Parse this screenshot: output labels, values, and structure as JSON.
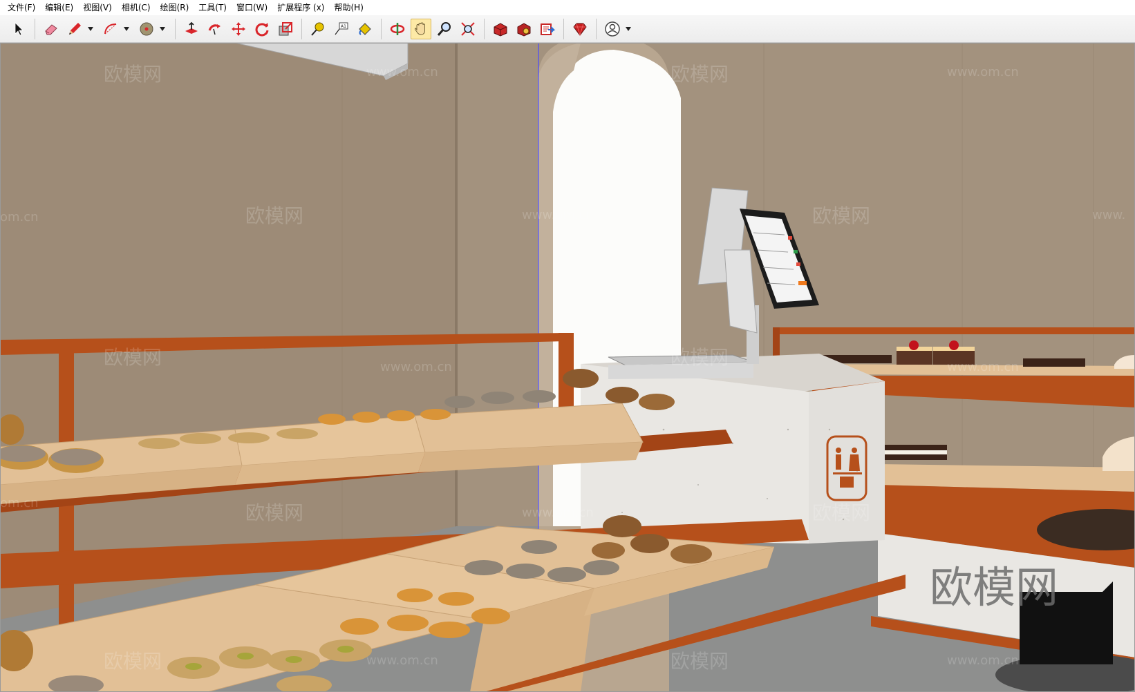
{
  "menubar": {
    "items": [
      {
        "id": "file",
        "label": "文件(F)"
      },
      {
        "id": "edit",
        "label": "编辑(E)"
      },
      {
        "id": "view",
        "label": "视图(V)"
      },
      {
        "id": "camera",
        "label": "相机(C)"
      },
      {
        "id": "draw",
        "label": "绘图(R)"
      },
      {
        "id": "tools",
        "label": "工具(T)"
      },
      {
        "id": "window",
        "label": "窗口(W)"
      },
      {
        "id": "extensions",
        "label": "扩展程序 (x)"
      },
      {
        "id": "help",
        "label": "帮助(H)"
      }
    ]
  },
  "toolbar": {
    "tools": [
      {
        "name": "select-tool",
        "icon": "arrow-cursor-icon"
      },
      {
        "name": "eraser-tool",
        "icon": "eraser-icon"
      },
      {
        "name": "pencil-tool",
        "icon": "pencil-icon",
        "dropdown": true
      },
      {
        "name": "arc-tool",
        "icon": "arc-icon",
        "dropdown": true
      },
      {
        "name": "shape-tool",
        "icon": "circle-shape-icon",
        "dropdown": true
      },
      {
        "name": "push-pull-tool",
        "icon": "push-pull-icon"
      },
      {
        "name": "follow-me-tool",
        "icon": "follow-me-icon"
      },
      {
        "name": "move-tool",
        "icon": "move-icon"
      },
      {
        "name": "rotate-tool",
        "icon": "rotate-icon"
      },
      {
        "name": "scale-tool",
        "icon": "scale-icon"
      },
      {
        "name": "tape-measure-tool",
        "icon": "tape-measure-icon"
      },
      {
        "name": "text-tool",
        "icon": "text-icon"
      },
      {
        "name": "paint-bucket-tool",
        "icon": "paint-bucket-icon"
      },
      {
        "name": "orbit-tool",
        "icon": "orbit-icon"
      },
      {
        "name": "pan-tool",
        "icon": "hand-pan-icon",
        "active": true
      },
      {
        "name": "zoom-tool",
        "icon": "zoom-icon"
      },
      {
        "name": "zoom-extents-tool",
        "icon": "zoom-extents-icon"
      },
      {
        "name": "3d-warehouse-button",
        "icon": "warehouse-icon"
      },
      {
        "name": "extension-warehouse-button",
        "icon": "extension-warehouse-icon"
      },
      {
        "name": "layout-button",
        "icon": "send-to-layout-icon"
      },
      {
        "name": "ruby-console-button",
        "icon": "ruby-gem-icon"
      },
      {
        "name": "account-button",
        "icon": "user-account-icon",
        "dropdown": true
      }
    ]
  },
  "viewport": {
    "watermark_brand": "欧模网",
    "watermark_url": "www.om.cn",
    "watermark_fragment": "om.cn",
    "watermark_fragment_right": "www.",
    "large_watermark": "欧模网",
    "colors": {
      "wall": "#9d8b77",
      "floor": "#8e8f8e",
      "shelf_frame": "#b6501b",
      "tray_wood": "#e2c096",
      "counter_stone": "#e9e7e3",
      "archway": "#fbfbf9",
      "axis_line": "#4a4aff"
    }
  }
}
